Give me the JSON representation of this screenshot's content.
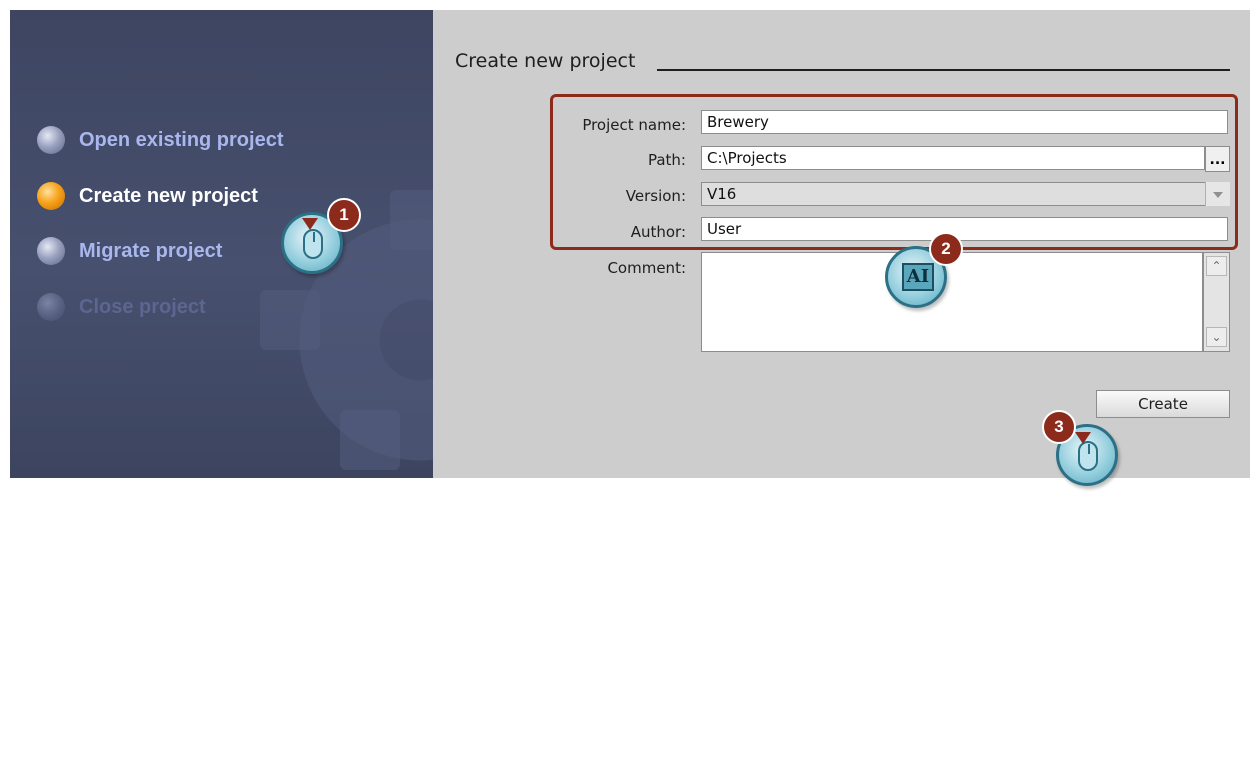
{
  "menu": {
    "items": [
      {
        "label": "Open existing project",
        "state": "normal"
      },
      {
        "label": "Create new project",
        "state": "active"
      },
      {
        "label": "Migrate project",
        "state": "normal"
      },
      {
        "label": "Close project",
        "state": "disabled"
      }
    ]
  },
  "form": {
    "title": "Create new project",
    "project_name_label": "Project name:",
    "project_name_value": "Brewery",
    "path_label": "Path:",
    "path_value": "C:\\Projects",
    "browse_label": "...",
    "version_label": "Version:",
    "version_value": "V16",
    "author_label": "Author:",
    "author_value": "User",
    "comment_label": "Comment:",
    "comment_value": "",
    "create_label": "Create"
  },
  "callouts": {
    "step1": "1",
    "step2": "2",
    "step3": "3",
    "ai_text": "AI"
  },
  "colors": {
    "active_bullet": "#f7a21a",
    "highlight_border": "#8c2b1b",
    "callout_border": "#2c7086"
  },
  "icons": [
    "mouse-click-icon",
    "keyboard-input-icon",
    "scroll-up-icon",
    "scroll-down-icon",
    "dropdown-arrow-icon"
  ]
}
